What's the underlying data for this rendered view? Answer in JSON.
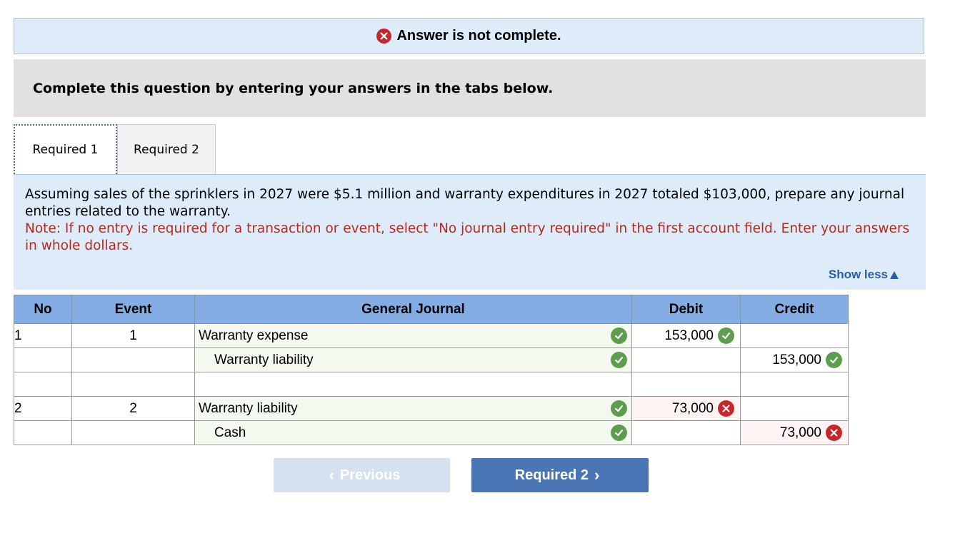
{
  "banner": {
    "status_text": "Answer is not complete.",
    "icon": "x-icon",
    "color": "#c8262a"
  },
  "instructions": {
    "text": "Complete this question by entering your answers in the tabs below."
  },
  "tabs": [
    {
      "label": "Required 1",
      "active": true
    },
    {
      "label": "Required 2",
      "active": false
    }
  ],
  "panel": {
    "question": "Assuming sales of the sprinklers in 2027 were $5.1 million and warranty expenditures in 2027 totaled $103,000, prepare any journal entries related to the warranty.",
    "note": "Note: If no entry is required for a transaction or event, select \"No journal entry required\" in the first account field. Enter your answers in whole dollars.",
    "show_less": "Show less"
  },
  "table": {
    "headers": {
      "no": "No",
      "event": "Event",
      "journal": "General Journal",
      "debit": "Debit",
      "credit": "Credit"
    },
    "rows": [
      {
        "no": "1",
        "event": "1",
        "account": "Warranty expense",
        "account_status": "correct",
        "debit": "153,000",
        "debit_status": "correct",
        "credit": "",
        "credit_status": ""
      },
      {
        "no": "",
        "event": "",
        "account": "Warranty liability",
        "account_status": "correct",
        "debit": "",
        "debit_status": "",
        "credit": "153,000",
        "credit_status": "correct"
      },
      {
        "no": "",
        "event": "",
        "account": "",
        "account_status": "",
        "debit": "",
        "debit_status": "",
        "credit": "",
        "credit_status": ""
      },
      {
        "no": "2",
        "event": "2",
        "account": "Warranty liability",
        "account_status": "correct",
        "debit": "73,000",
        "debit_status": "wrong",
        "credit": "",
        "credit_status": ""
      },
      {
        "no": "",
        "event": "",
        "account": "Cash",
        "account_status": "correct",
        "debit": "",
        "debit_status": "",
        "credit": "73,000",
        "credit_status": "wrong"
      }
    ]
  },
  "buttons": {
    "previous": "Previous",
    "next": "Required 2"
  },
  "colors": {
    "correct": "#5c9d4e",
    "wrong": "#c8262a",
    "header": "#84aee3",
    "accent": "#4a76b5"
  }
}
